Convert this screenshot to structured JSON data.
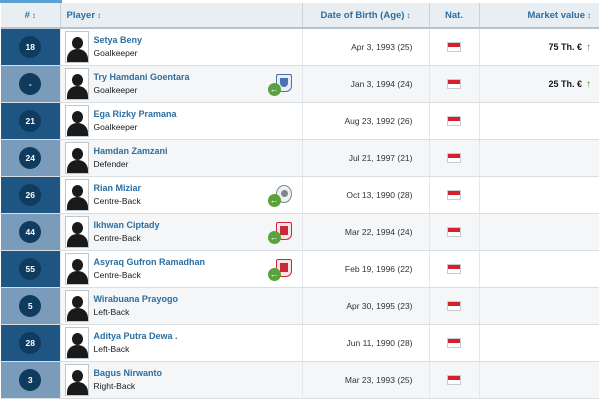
{
  "header": {
    "num": "#",
    "player": "Player",
    "dob": "Date of Birth (Age)",
    "nat": "Nat.",
    "market_value": "Market value",
    "sort_glyph": "↕"
  },
  "colors": {
    "accent": "#5aa1d2",
    "link": "#2b6ea1",
    "badge": "#0f3b5f",
    "flag_red": "#d5202f",
    "trend_up": "#3f9a2b"
  },
  "players": [
    {
      "number": "18",
      "name": "Setya Beny",
      "position": "Goalkeeper",
      "dob": "Apr 3, 1993 (25)",
      "nationality_icon": "indonesia-flag-icon",
      "market_value": "75 Th. €",
      "trend": "↑",
      "transfer_icon": "",
      "arrow": ""
    },
    {
      "number": "-",
      "name": "Try Hamdani Goentara",
      "position": "Goalkeeper",
      "dob": "Jan 3, 1994 (24)",
      "nationality_icon": "indonesia-flag-icon",
      "market_value": "25 Th. €",
      "trend": "↑",
      "transfer_icon": "blue-club-crest-icon",
      "arrow": "←"
    },
    {
      "number": "21",
      "name": "Ega Rizky Pramana",
      "position": "Goalkeeper",
      "dob": "Aug 23, 1992 (26)",
      "nationality_icon": "indonesia-flag-icon",
      "market_value": "",
      "trend": "",
      "transfer_icon": "",
      "arrow": ""
    },
    {
      "number": "24",
      "name": "Hamdan Zamzani",
      "position": "Defender",
      "dob": "Jul 21, 1997 (21)",
      "nationality_icon": "indonesia-flag-icon",
      "market_value": "",
      "trend": "",
      "transfer_icon": "",
      "arrow": ""
    },
    {
      "number": "26",
      "name": "Rian Miziar",
      "position": "Centre-Back",
      "dob": "Oct 13, 1990 (28)",
      "nationality_icon": "indonesia-flag-icon",
      "market_value": "",
      "trend": "",
      "transfer_icon": "grey-club-crest-icon",
      "arrow": "←"
    },
    {
      "number": "44",
      "name": "Ikhwan Ciptady",
      "position": "Centre-Back",
      "dob": "Mar 22, 1994 (24)",
      "nationality_icon": "indonesia-flag-icon",
      "market_value": "",
      "trend": "",
      "transfer_icon": "red-club-crest-icon",
      "arrow": "←"
    },
    {
      "number": "55",
      "name": "Asyraq Gufron Ramadhan",
      "position": "Centre-Back",
      "dob": "Feb 19, 1996 (22)",
      "nationality_icon": "indonesia-flag-icon",
      "market_value": "",
      "trend": "",
      "transfer_icon": "red-club-crest-icon",
      "arrow": "←"
    },
    {
      "number": "5",
      "name": "Wirabuana Prayogo",
      "position": "Left-Back",
      "dob": "Apr 30, 1995 (23)",
      "nationality_icon": "indonesia-flag-icon",
      "market_value": "",
      "trend": "",
      "transfer_icon": "",
      "arrow": ""
    },
    {
      "number": "28",
      "name": "Aditya Putra Dewa .",
      "position": "Left-Back",
      "dob": "Jun 11, 1990 (28)",
      "nationality_icon": "indonesia-flag-icon",
      "market_value": "",
      "trend": "",
      "transfer_icon": "",
      "arrow": ""
    },
    {
      "number": "3",
      "name": "Bagus Nirwanto",
      "position": "Right-Back",
      "dob": "Mar 23, 1993 (25)",
      "nationality_icon": "indonesia-flag-icon",
      "market_value": "",
      "trend": "",
      "transfer_icon": "",
      "arrow": ""
    }
  ]
}
